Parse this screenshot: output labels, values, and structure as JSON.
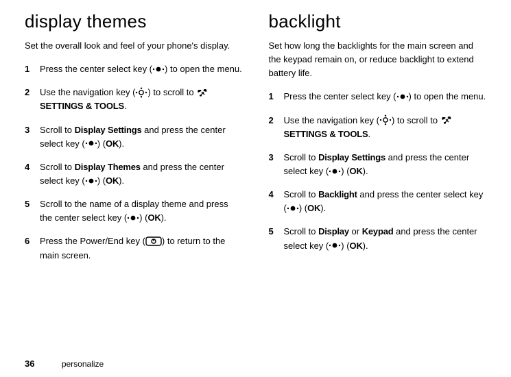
{
  "left": {
    "heading": "display themes",
    "intro": "Set the overall look and feel of your phone's display.",
    "steps": [
      {
        "num": "1",
        "parts": [
          "Press the center select key (",
          {
            "icon": "center-select"
          },
          ") to open the menu."
        ]
      },
      {
        "num": "2",
        "parts": [
          "Use the navigation key (",
          {
            "icon": "nav-key"
          },
          ") to scroll to ",
          {
            "icon": "tools"
          },
          " ",
          {
            "b": "SETTINGS & TOOLS"
          },
          "."
        ]
      },
      {
        "num": "3",
        "parts": [
          "Scroll to ",
          {
            "b": "Display Settings"
          },
          " and press the center select key (",
          {
            "icon": "center-select"
          },
          ") (",
          {
            "b": "OK"
          },
          ")."
        ]
      },
      {
        "num": "4",
        "parts": [
          "Scroll to ",
          {
            "b": "Display Themes"
          },
          " and press the center select key (",
          {
            "icon": "center-select"
          },
          ") (",
          {
            "b": "OK"
          },
          ")."
        ]
      },
      {
        "num": "5",
        "parts": [
          "Scroll to the name of a display theme and press the center select key (",
          {
            "icon": "center-select"
          },
          ") (",
          {
            "b": "OK"
          },
          ")."
        ]
      },
      {
        "num": "6",
        "parts": [
          "Press the Power/End key (",
          {
            "icon": "power-key"
          },
          ") to return to the main screen."
        ]
      }
    ]
  },
  "right": {
    "heading": "backlight",
    "intro": "Set how long the backlights for the main screen and the keypad remain on, or reduce backlight to extend battery life.",
    "steps": [
      {
        "num": "1",
        "parts": [
          "Press the center select key (",
          {
            "icon": "center-select"
          },
          ") to open the menu."
        ]
      },
      {
        "num": "2",
        "parts": [
          "Use the navigation key (",
          {
            "icon": "nav-key"
          },
          ") to scroll to ",
          {
            "icon": "tools"
          },
          " ",
          {
            "b": "SETTINGS & TOOLS"
          },
          "."
        ]
      },
      {
        "num": "3",
        "parts": [
          "Scroll to ",
          {
            "b": "Display Settings"
          },
          " and press the center select key (",
          {
            "icon": "center-select"
          },
          ") (",
          {
            "b": "OK"
          },
          ")."
        ]
      },
      {
        "num": "4",
        "parts": [
          "Scroll to ",
          {
            "b": "Backlight"
          },
          " and press the center select key (",
          {
            "icon": "center-select"
          },
          ") (",
          {
            "b": "OK"
          },
          ")."
        ]
      },
      {
        "num": "5",
        "parts": [
          "Scroll to ",
          {
            "b": "Display"
          },
          " or ",
          {
            "b": "Keypad"
          },
          " and press the center select key (",
          {
            "icon": "center-select"
          },
          ") (",
          {
            "b": "OK"
          },
          ")."
        ]
      }
    ]
  },
  "footer": {
    "page": "36",
    "section": "personalize"
  }
}
